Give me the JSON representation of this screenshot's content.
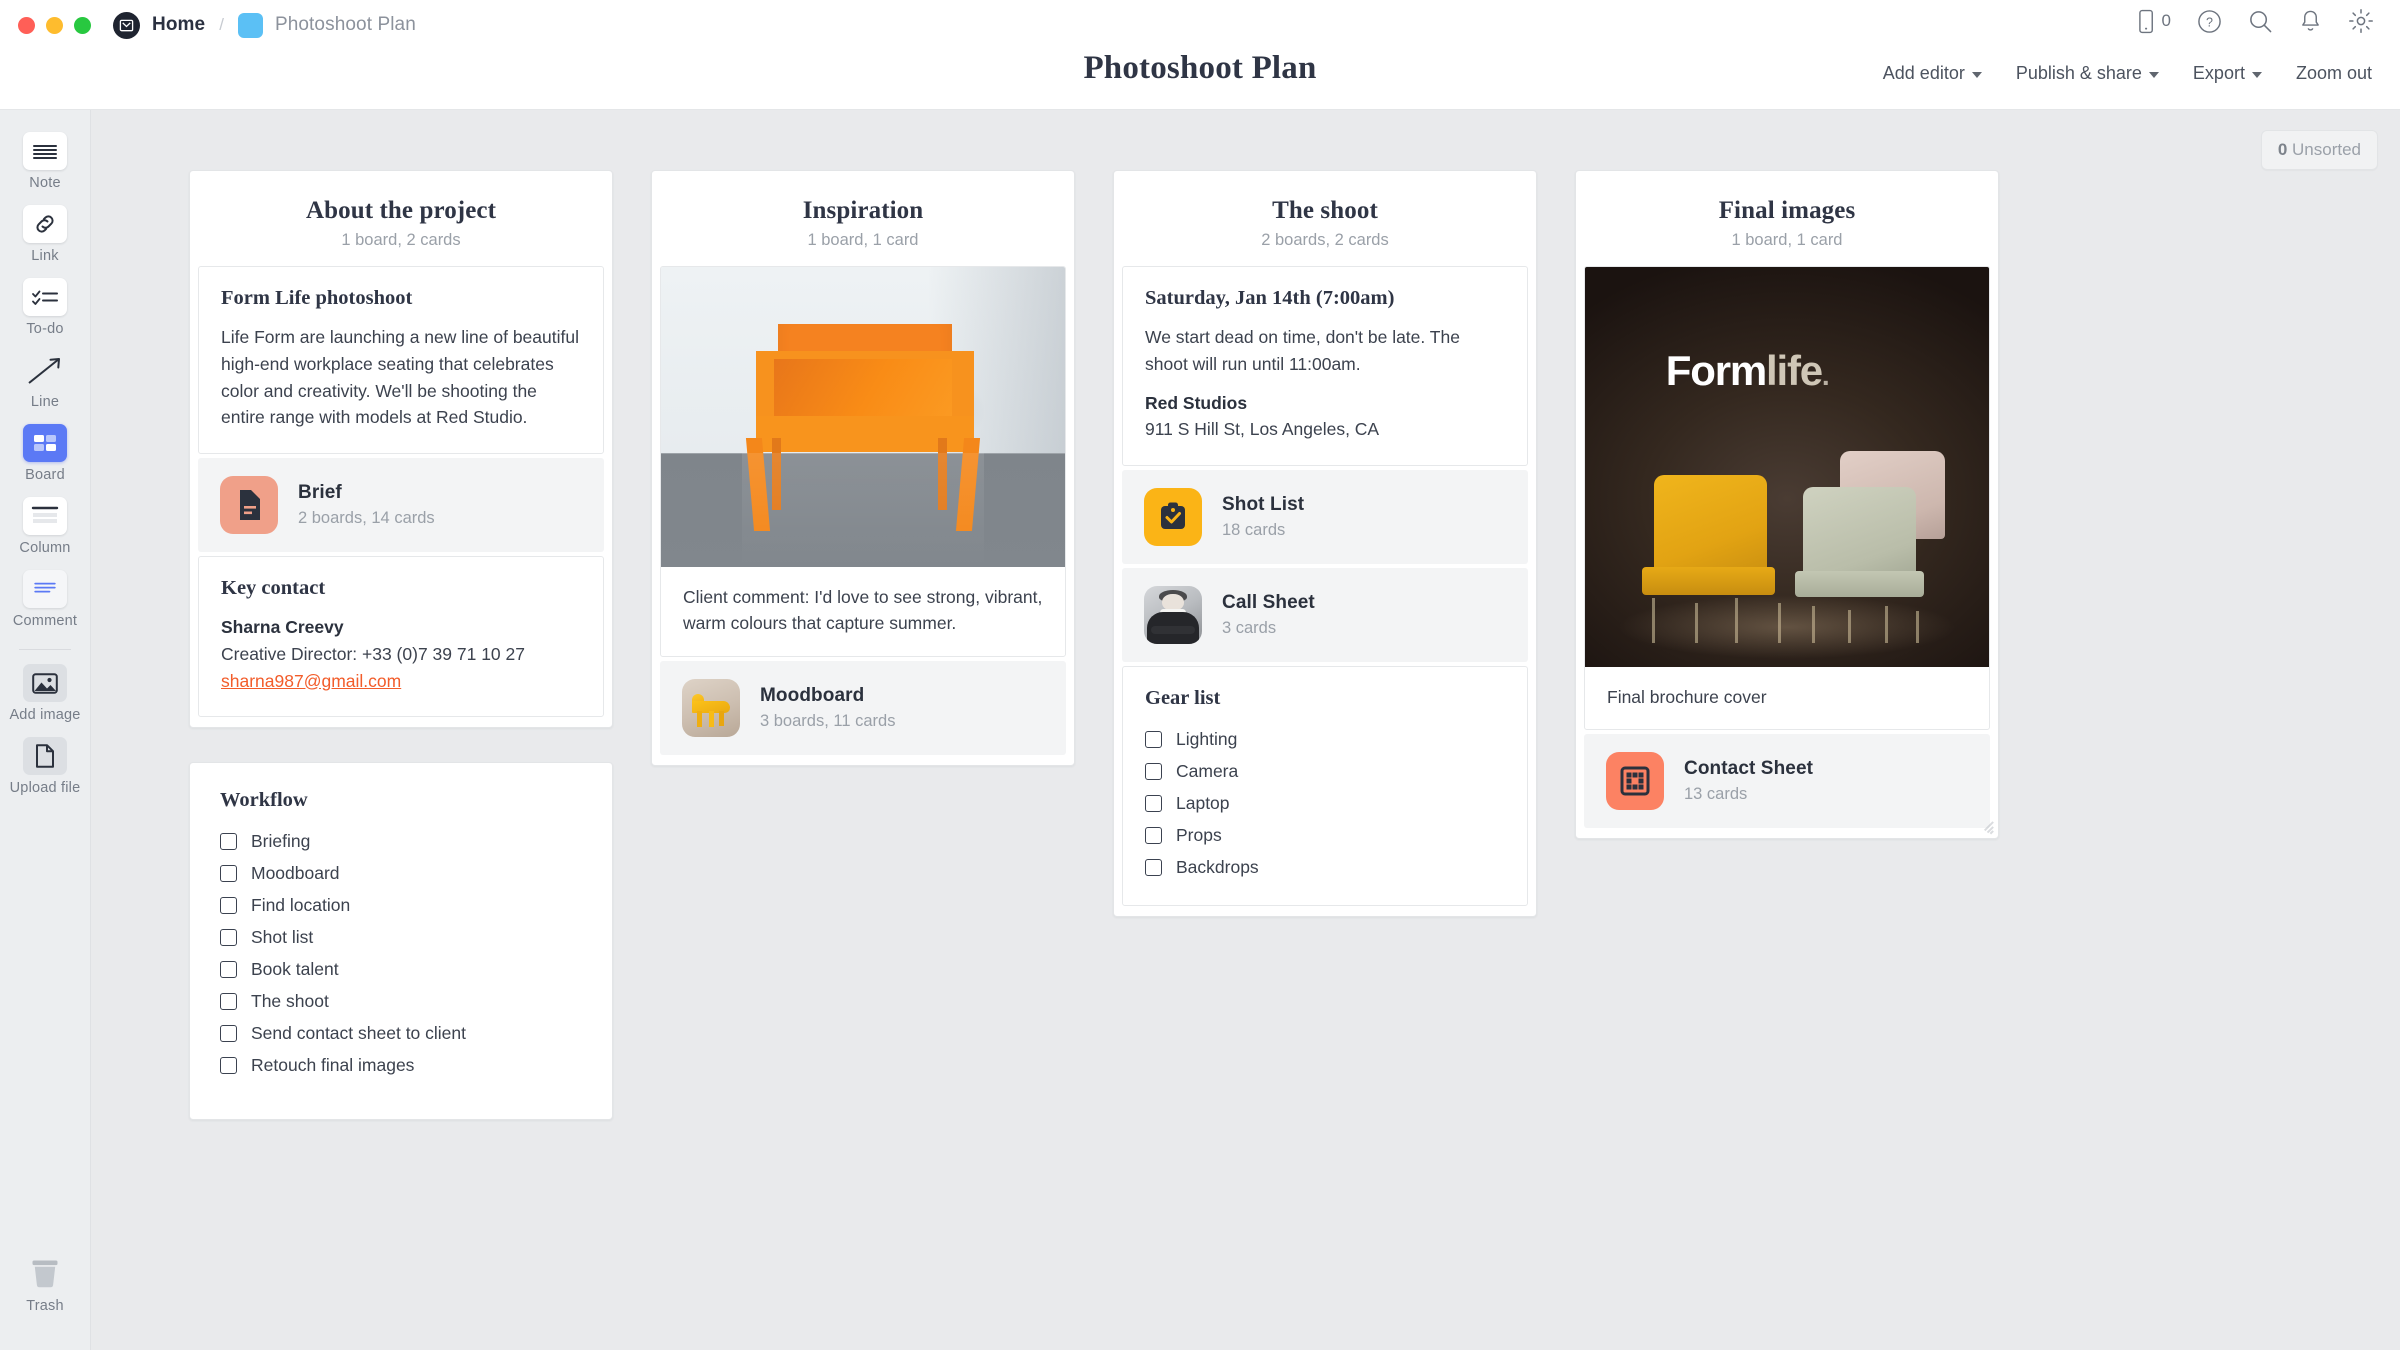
{
  "window": {
    "traffic_lights": [
      "close",
      "minimize",
      "zoom"
    ]
  },
  "breadcrumb": {
    "home": "Home",
    "separator": "/",
    "current": "Photoshoot Plan"
  },
  "header": {
    "title": "Photoshoot Plan",
    "device_count": "0",
    "icons": [
      "mobile-icon",
      "help-icon",
      "search-icon",
      "notification-icon",
      "settings-icon"
    ],
    "actions": [
      {
        "label": "Add editor",
        "has_chevron": true
      },
      {
        "label": "Publish & share",
        "has_chevron": true
      },
      {
        "label": "Export",
        "has_chevron": true
      },
      {
        "label": "Zoom out",
        "has_chevron": false
      }
    ]
  },
  "sidebar": {
    "tools": [
      {
        "label": "Note",
        "icon": "note-icon"
      },
      {
        "label": "Link",
        "icon": "link-icon"
      },
      {
        "label": "To-do",
        "icon": "todo-icon"
      },
      {
        "label": "Line",
        "icon": "line-icon"
      },
      {
        "label": "Board",
        "icon": "board-icon",
        "active": true
      },
      {
        "label": "Column",
        "icon": "column-icon"
      },
      {
        "label": "Comment",
        "icon": "comment-icon"
      },
      {
        "label": "Add image",
        "icon": "image-icon"
      },
      {
        "label": "Upload file",
        "icon": "file-icon"
      }
    ],
    "trash": {
      "label": "Trash",
      "icon": "trash-icon"
    }
  },
  "canvas": {
    "unsorted_count": "0",
    "unsorted_label": "Unsorted"
  },
  "columns": [
    {
      "title": "About the project",
      "subtitle": "1 board, 2 cards",
      "items": [
        {
          "type": "note",
          "title": "Form Life photoshoot",
          "body": "Life Form are launching a new line of beautiful high-end workplace seating that celebrates color and creativity. We'll be shooting the entire range with models at Red Studio."
        },
        {
          "type": "board",
          "name": "Brief",
          "count": "2 boards, 14 cards",
          "thumb": "document-icon",
          "thumb_color": "#f0a089"
        },
        {
          "type": "contact",
          "title": "Key contact",
          "name": "Sharna Creevy",
          "role": "Creative Director: +33 (0)7 39 71 10 27",
          "email": "sharna987@gmail.com"
        }
      ],
      "extra_card": {
        "type": "checklist",
        "title": "Workflow",
        "items": [
          "Briefing",
          "Moodboard",
          "Find location",
          "Shot list",
          "Book talent",
          "The shoot",
          "Send contact sheet to client",
          "Retouch final images"
        ]
      }
    },
    {
      "title": "Inspiration",
      "subtitle": "1 board, 1 card",
      "items": [
        {
          "type": "image",
          "image": "orange-chair-photo",
          "caption": "Client comment: I'd love to see strong, vibrant, warm colours that capture summer."
        },
        {
          "type": "board",
          "name": "Moodboard",
          "count": "3 boards, 11 cards",
          "thumb": "moodboard-chair-thumb"
        }
      ]
    },
    {
      "title": "The shoot",
      "subtitle": "2 boards, 2 cards",
      "items": [
        {
          "type": "note",
          "title": "Saturday, Jan 14th (7:00am)",
          "body": "We start dead on time, don't be late. The shoot will run until 11:00am.",
          "venue": "Red Studios",
          "address": "911 S Hill St, Los Angeles, CA"
        },
        {
          "type": "board",
          "name": "Shot List",
          "count": "18 cards",
          "thumb": "clipboard-check-icon",
          "thumb_color": "#fbb416"
        },
        {
          "type": "board",
          "name": "Call Sheet",
          "count": "3 cards",
          "thumb": "model-portrait-thumb"
        },
        {
          "type": "checklist",
          "title": "Gear list",
          "items": [
            "Lighting",
            "Camera",
            "Laptop",
            "Props",
            "Backdrops"
          ]
        }
      ]
    },
    {
      "title": "Final images",
      "subtitle": "1 board, 1 card",
      "items": [
        {
          "type": "image",
          "image": "formlife-brochure-cover",
          "brand_part1": "Form",
          "brand_part2": "life",
          "brand_part3": ".",
          "caption": "Final brochure cover"
        },
        {
          "type": "board",
          "name": "Contact Sheet",
          "count": "13 cards",
          "thumb": "grid-icon",
          "thumb_color": "#fc8263"
        }
      ]
    }
  ],
  "colors": {
    "accent_blue": "#5b79f5",
    "link_orange": "#f25c2a",
    "swatch_blue": "#5bc0f5",
    "canvas_bg": "#e9eaec",
    "text_dark": "#2f3545",
    "text_muted": "#9aa0a8"
  }
}
